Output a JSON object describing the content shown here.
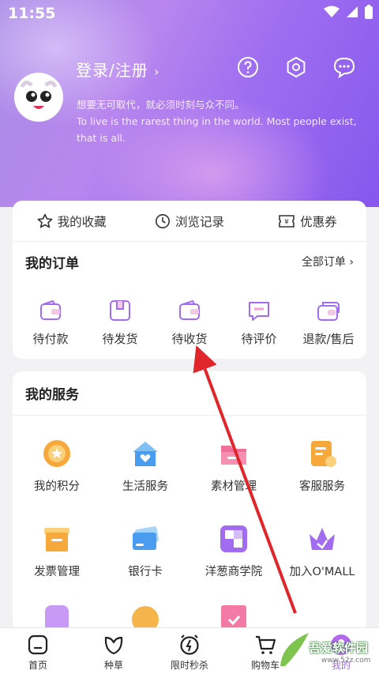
{
  "status_bar": {
    "time": "11:55"
  },
  "profile": {
    "login_label": "登录/注册",
    "motto_cn": "想要无可取代，就必须时刻与众不同。",
    "motto_en": "To live is the rarest thing in the world. Most people exist, that is all."
  },
  "quick_links": [
    {
      "label": "我的收藏",
      "icon": "star-icon"
    },
    {
      "label": "浏览记录",
      "icon": "clock-icon"
    },
    {
      "label": "优惠券",
      "icon": "coupon-icon"
    }
  ],
  "orders": {
    "title": "我的订单",
    "all_link": "全部订单",
    "items": [
      {
        "label": "待付款",
        "icon": "wallet-icon"
      },
      {
        "label": "待发货",
        "icon": "box-icon"
      },
      {
        "label": "待收货",
        "icon": "wallet-receive-icon"
      },
      {
        "label": "待评价",
        "icon": "comment-icon"
      },
      {
        "label": "退款/售后",
        "icon": "refund-icon"
      }
    ]
  },
  "services": {
    "title": "我的服务",
    "items": [
      {
        "label": "我的积分",
        "icon": "points-icon",
        "color": "#f6a83a"
      },
      {
        "label": "生活服务",
        "icon": "home-heart-icon",
        "color": "#4a9cf0"
      },
      {
        "label": "素材管理",
        "icon": "folder-icon",
        "color": "#f06e9a"
      },
      {
        "label": "客服服务",
        "icon": "service-icon",
        "color": "#f6a83a"
      },
      {
        "label": "发票管理",
        "icon": "invoice-icon",
        "color": "#f6a83a"
      },
      {
        "label": "银行卡",
        "icon": "bank-card-icon",
        "color": "#4a9cf0"
      },
      {
        "label": "洋葱商学院",
        "icon": "academy-icon",
        "color": "#a26cf0"
      },
      {
        "label": "加入O'MALL",
        "icon": "crown-icon",
        "color": "#a26cf0"
      }
    ]
  },
  "tabbar": [
    {
      "label": "首页",
      "icon": "home-icon"
    },
    {
      "label": "种草",
      "icon": "leaf-icon"
    },
    {
      "label": "限时秒杀",
      "icon": "timer-icon"
    },
    {
      "label": "购物车",
      "icon": "cart-icon"
    },
    {
      "label": "我的",
      "icon": "profile-icon"
    }
  ],
  "watermark": {
    "text": "吾爱软件园",
    "url": "www.52z.com"
  },
  "colors": {
    "accent": "#a26cf0",
    "arrow": "#e0262b"
  }
}
